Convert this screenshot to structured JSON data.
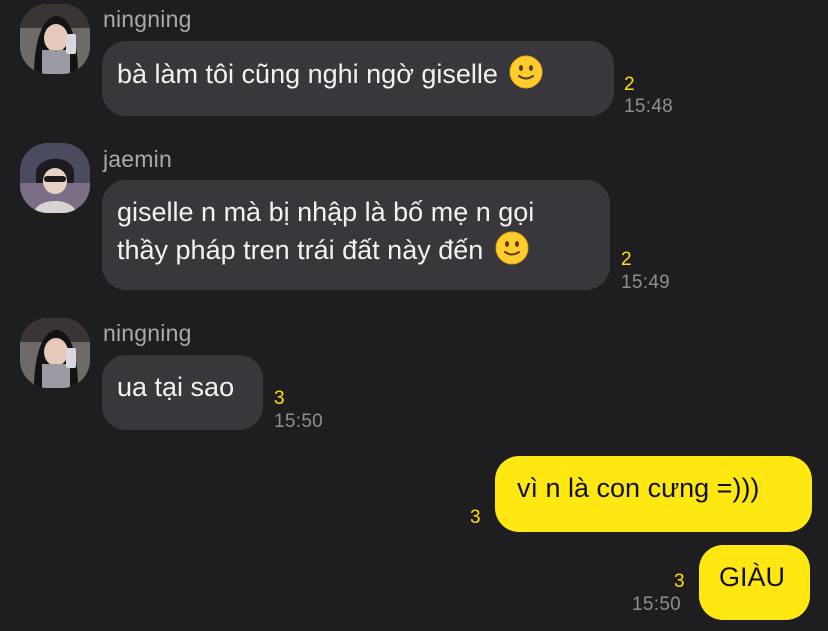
{
  "messages": [
    {
      "sender": "ningning",
      "avatar_icon": "ningning-avatar",
      "text": "bà làm tôi cũng nghi ngờ giselle",
      "emoji": "slight-smile-emoji",
      "unread": "2",
      "time": "15:48"
    },
    {
      "sender": "jaemin",
      "avatar_icon": "jaemin-avatar",
      "lines": [
        "giselle n mà bị nhập là bố mẹ n gọi",
        "thầy pháp tren trái đất này đến"
      ],
      "emoji": "slight-smile-emoji",
      "unread": "2",
      "time": "15:49"
    },
    {
      "sender": "ningning",
      "avatar_icon": "ningning-avatar",
      "text": "ua tại sao",
      "unread": "3",
      "time": "15:50"
    },
    {
      "mine": true,
      "text": "vì n là con cưng =)))",
      "unread": "3"
    },
    {
      "mine": true,
      "text": "GIÀU",
      "unread": "3",
      "time": "15:50"
    }
  ],
  "colors": {
    "background": "#1e1e20",
    "incoming_bubble": "#38383c",
    "outgoing_bubble": "#ffe812",
    "unread_count": "#ffe000",
    "timestamp": "#8e8e93"
  }
}
